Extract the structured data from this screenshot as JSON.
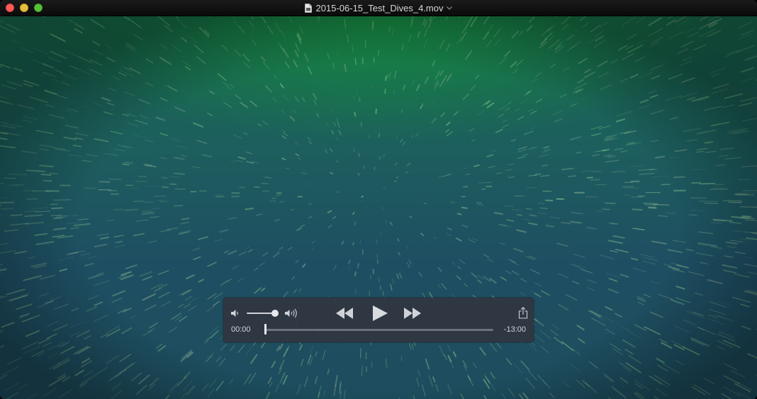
{
  "window": {
    "title": "2015-06-15_Test_Dives_4.mov"
  },
  "colors": {
    "close": "#fc5b57",
    "minimize": "#e5bf3c",
    "maximize": "#57c038",
    "controls_bg": "#303640",
    "water_top": "#168c3c",
    "water_bottom": "#1d4d5d"
  },
  "controls": {
    "icons": {
      "volume_low": "volume-low-icon",
      "volume_high": "volume-high-icon",
      "rewind": "rewind-icon",
      "play": "play-icon",
      "fast_forward": "fast-forward-icon",
      "share": "share-icon"
    },
    "volume_level": 0.95,
    "playback_position": 0.0,
    "elapsed": "00:00",
    "remaining": "-13:00"
  }
}
